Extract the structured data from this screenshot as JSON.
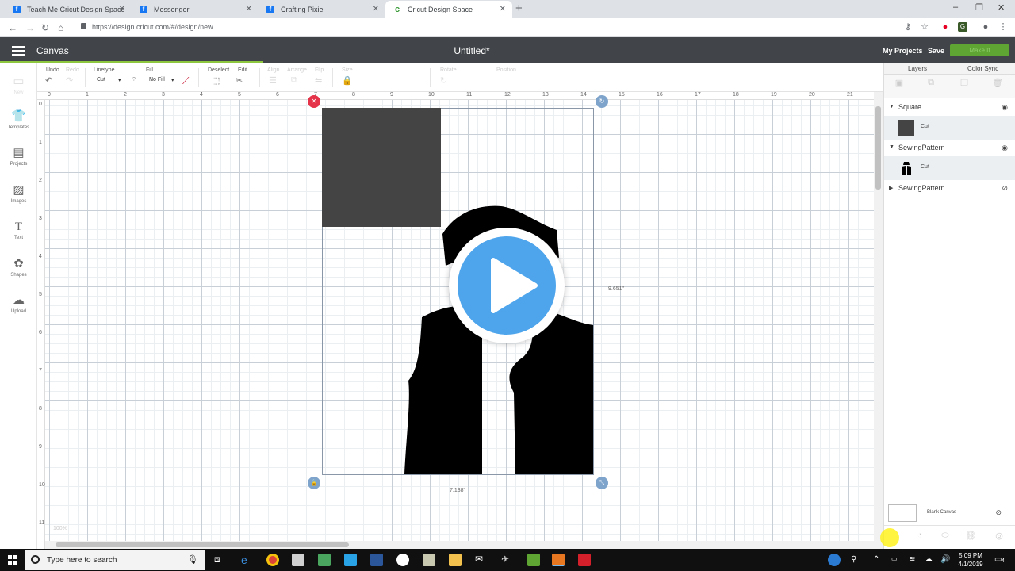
{
  "browser": {
    "tabs": [
      {
        "label": "Teach Me Cricut Design Space",
        "favicon": "facebook-icon"
      },
      {
        "label": "Messenger",
        "favicon": "facebook-icon"
      },
      {
        "label": "Crafting Pixie",
        "favicon": "facebook-icon"
      },
      {
        "label": "Cricut Design Space",
        "favicon": "cricut-icon"
      }
    ],
    "url": "https://design.cricut.com/#/design/new"
  },
  "header": {
    "section": "Canvas",
    "doc_title": "Untitled*",
    "my_projects": "My Projects",
    "save": "Save",
    "make": "Make It",
    "accent": "#8dc63f"
  },
  "toolbar": {
    "undo": "Undo",
    "redo": "Redo",
    "linetype_label": "Linetype",
    "linetype_value": "Cut",
    "fill_label": "Fill",
    "fill_value": "No Fill",
    "deselect": "Deselect",
    "edit": "Edit",
    "align": "Align",
    "arrange": "Arrange",
    "flip": "Flip",
    "size": "Size",
    "rotate": "Rotate",
    "position": "Position"
  },
  "leftbar": [
    {
      "label": "New",
      "icon": "new-icon"
    },
    {
      "label": "Templates",
      "icon": "shirt-icon"
    },
    {
      "label": "Projects",
      "icon": "projects-icon"
    },
    {
      "label": "Images",
      "icon": "image-icon"
    },
    {
      "label": "Text",
      "icon": "text-icon"
    },
    {
      "label": "Shapes",
      "icon": "shapes-icon"
    },
    {
      "label": "Upload",
      "icon": "upload-icon"
    }
  ],
  "rulers": {
    "top": [
      "0",
      "1",
      "2",
      "3",
      "4",
      "5",
      "6",
      "7",
      "8",
      "9",
      "10",
      "11",
      "12",
      "13",
      "14",
      "15",
      "16",
      "17",
      "18",
      "19",
      "20",
      "21"
    ],
    "left": [
      "0",
      "1",
      "2",
      "3",
      "4",
      "5",
      "6",
      "7",
      "8",
      "9",
      "10",
      "11"
    ]
  },
  "canvas": {
    "height_dim": "9.651\"",
    "width_dim": "7.138\"",
    "zoom": "100%",
    "square_color": "#444444",
    "pattern_color": "#000000"
  },
  "panel": {
    "tab_layers": "Layers",
    "tab_colorsync": "Color Sync",
    "tools": [
      "Group",
      "UnGroup",
      "Duplicate",
      "Delete"
    ],
    "layers": [
      {
        "name": "Square",
        "sub": "Cut",
        "expanded": true,
        "visible": true
      },
      {
        "name": "SewingPattern",
        "sub": "Cut",
        "expanded": true,
        "visible": true
      },
      {
        "name": "SewingPattern",
        "expanded": false,
        "visible": false
      }
    ],
    "blank_canvas": "Blank Canvas",
    "bottom_tools": [
      "Slice",
      "Weld",
      "Attach",
      "Flatten",
      "Contour"
    ]
  },
  "taskbar": {
    "search_placeholder": "Type here to search",
    "time": "5:09 PM",
    "date": "4/1/2019",
    "notifications": "4"
  },
  "play_color": "#4ea5ec"
}
